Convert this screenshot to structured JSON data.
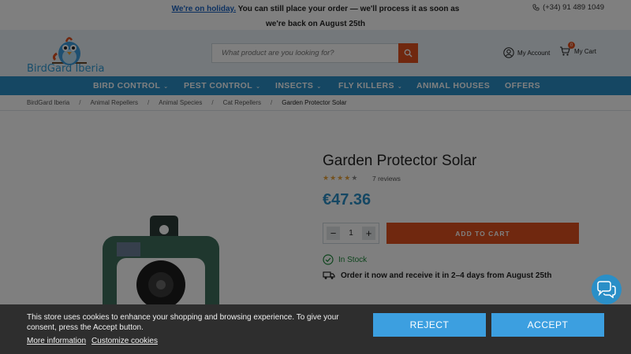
{
  "notice": {
    "link": "We're on holiday.",
    "line1_rest": " You can still place your order — we'll process it as soon as",
    "line2": "we're back on August 25th"
  },
  "phone": "(+34) 91 489 1049",
  "logo": {
    "text": "BirdGard Iberia"
  },
  "search": {
    "placeholder": "What product are you looking for?"
  },
  "account": {
    "label": "My Account"
  },
  "cart": {
    "label": "My Cart",
    "count": "0"
  },
  "nav": {
    "items": [
      {
        "label": "BIRD CONTROL",
        "chev": "⌄"
      },
      {
        "label": "PEST CONTROL",
        "chev": "⌄"
      },
      {
        "label": "INSECTS",
        "chev": "⌄"
      },
      {
        "label": "FLY KILLERS",
        "chev": "⌄"
      },
      {
        "label": "ANIMAL HOUSES"
      },
      {
        "label": "OFFERS"
      }
    ]
  },
  "breadcrumb": {
    "sep": "/",
    "items": [
      "BirdGard Iberia",
      "Animal Repellers",
      "Animal Species",
      "Cat Repellers"
    ],
    "current": "Garden Protector Solar"
  },
  "product": {
    "title": "Garden Protector Solar",
    "rating": 4,
    "reviews": "7 reviews",
    "price": "€47.36",
    "quantity": "1",
    "qty_minus": "−",
    "qty_plus": "+",
    "add_to_cart": "ADD TO CART",
    "stock": "In Stock",
    "delivery": "Order it now and receive it in 2–4 days from August 25th"
  },
  "cookie": {
    "text": "This store uses cookies to enhance your shopping and browsing experience. To give your consent, press the Accept button.",
    "more_info": "More information",
    "customize": "Customize cookies",
    "reject": "REJECT",
    "accept": "ACCEPT"
  },
  "colors": {
    "accent": "#2a8fc7",
    "cta": "#e0501e",
    "header_bg": "#e8f1f7",
    "cookie_btn": "#3c9fe0",
    "stock_green": "#1c8a3a"
  }
}
